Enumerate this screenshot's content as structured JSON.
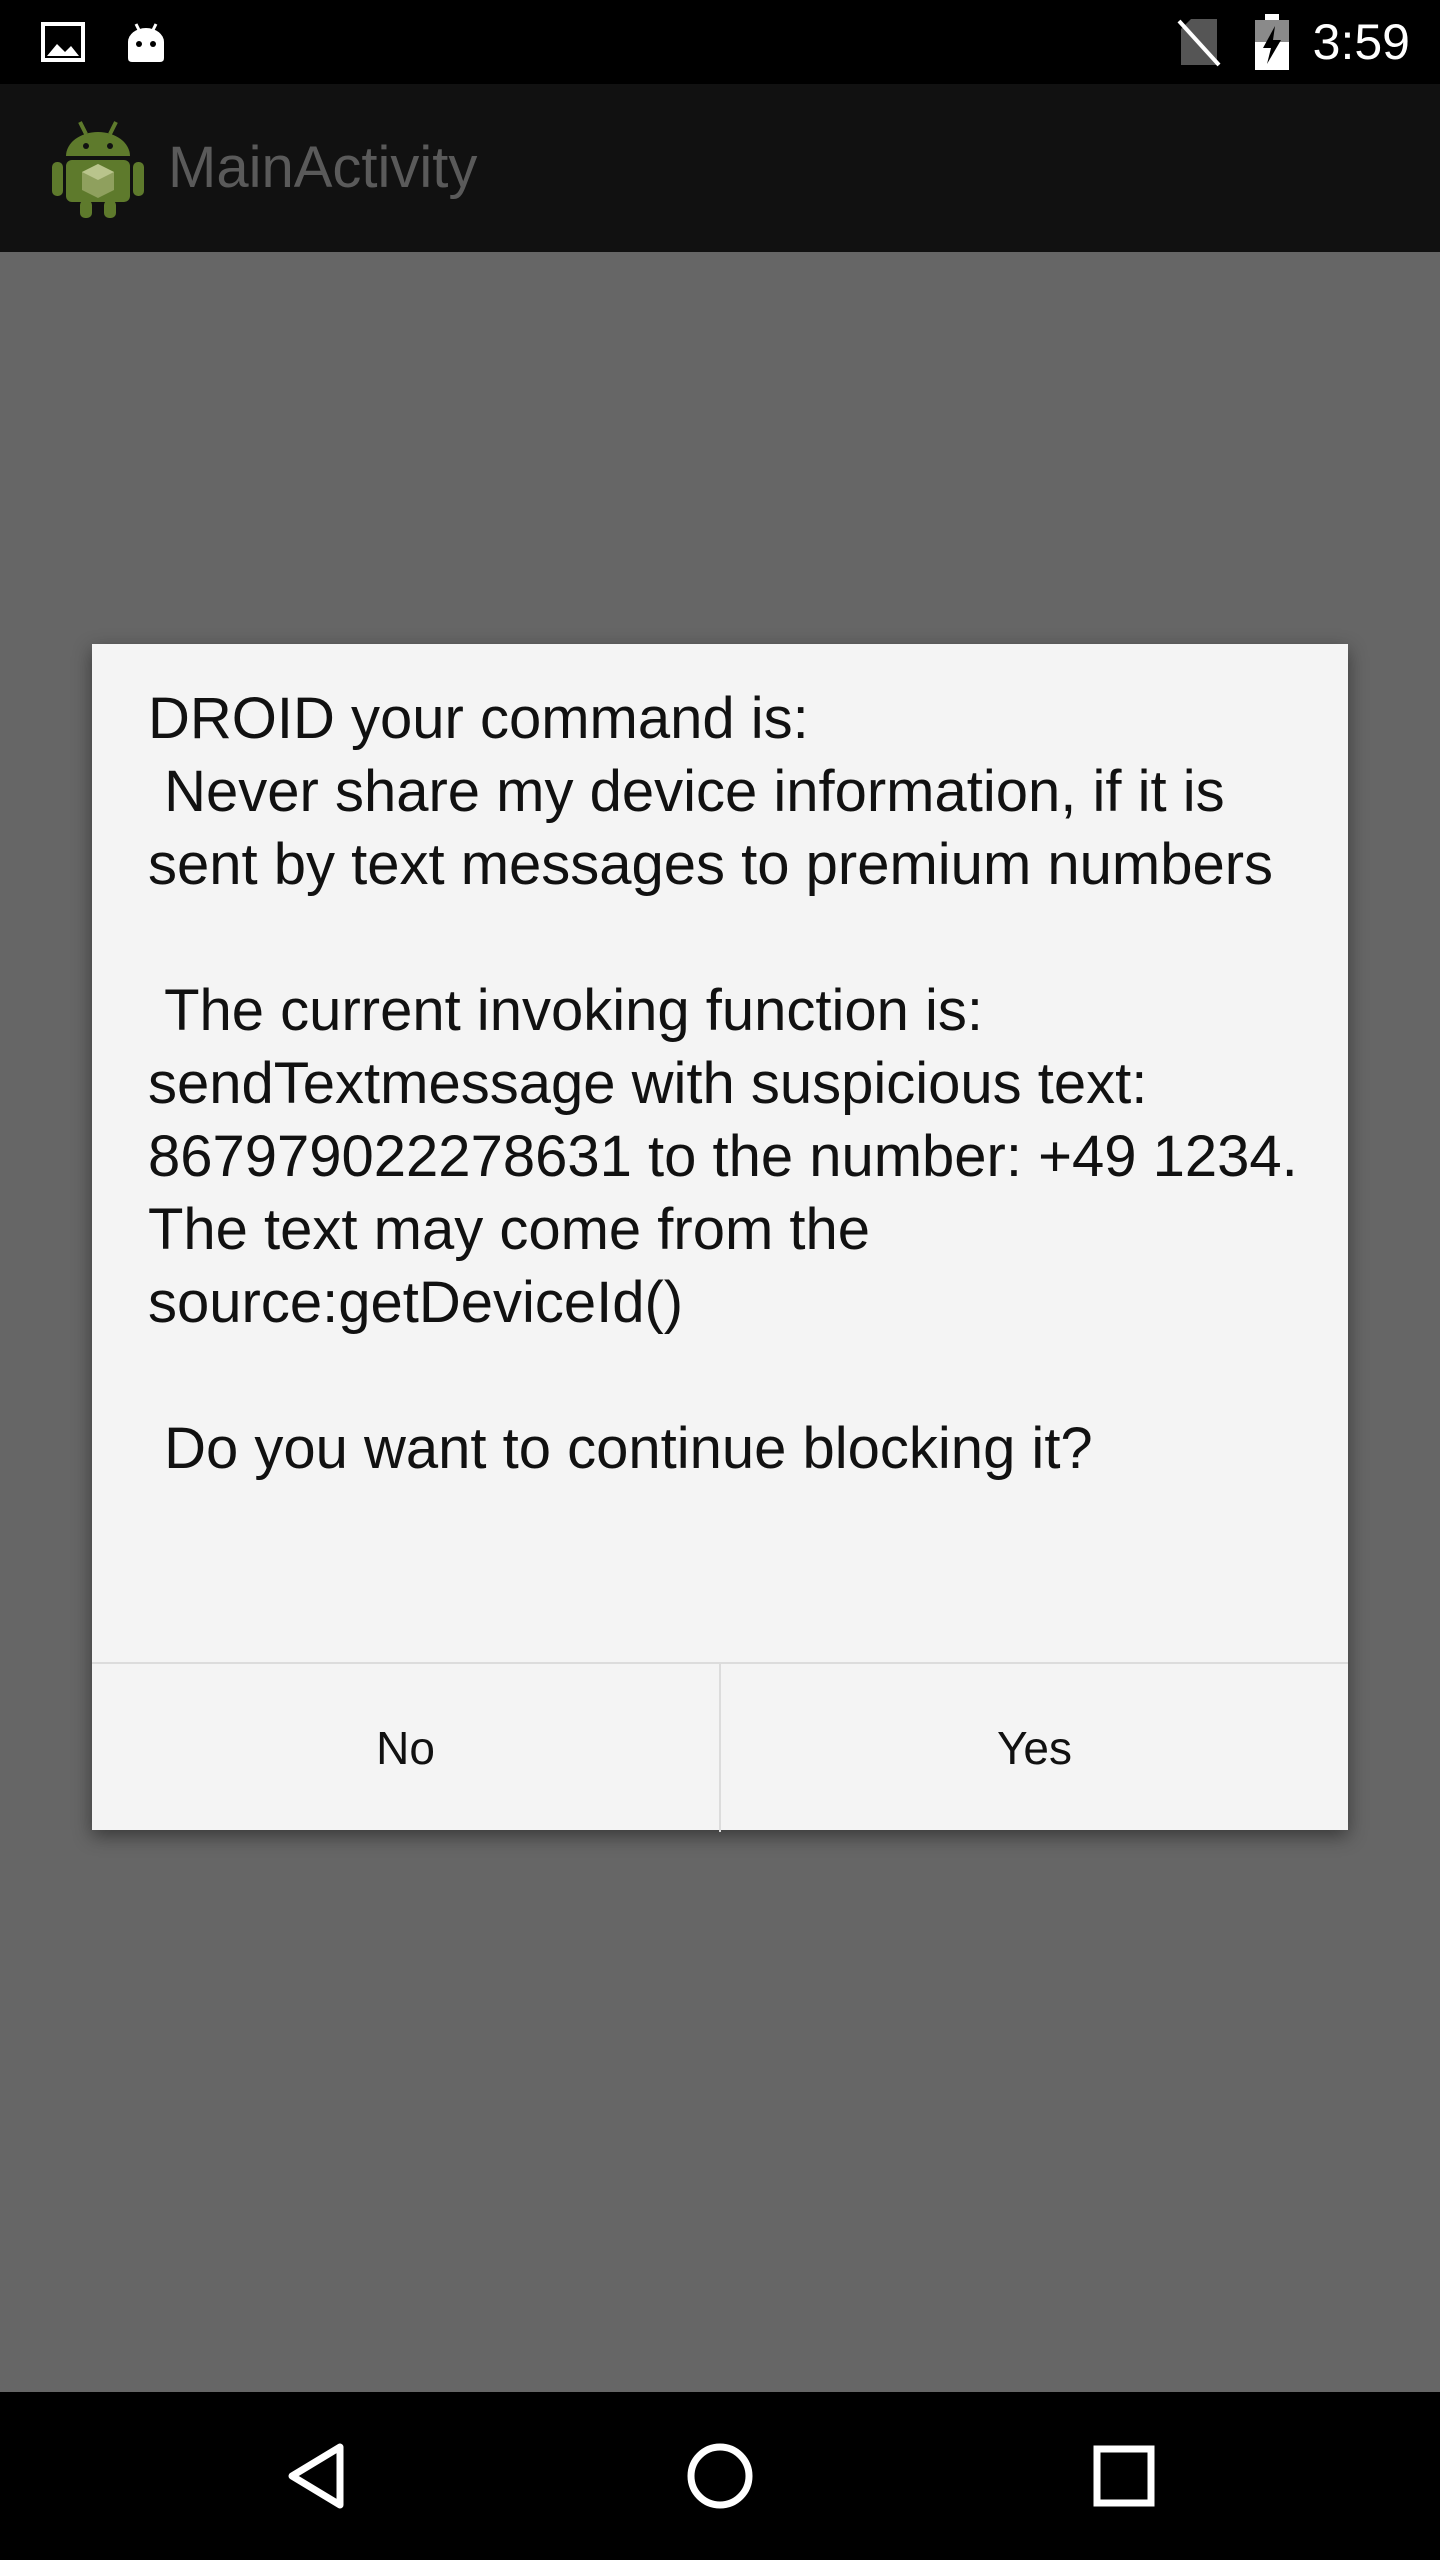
{
  "status_bar": {
    "time": "3:59",
    "icons": [
      "image-icon",
      "android-icon",
      "no-sim-icon",
      "battery-charging-icon"
    ]
  },
  "action_bar": {
    "title": "MainActivity",
    "icon": "android-app-icon"
  },
  "dialog": {
    "message": "DROID your command is:\n Never share my device information, if it is sent by text messages to premium numbers\n\n The current invoking function is: sendTextmessage with suspicious text: 867979022278631 to the number: +49 1234.\nThe text may come from the source:getDeviceId()\n\n Do you want to continue blocking it?",
    "buttons": {
      "no": "No",
      "yes": "Yes"
    }
  },
  "nav_bar": {
    "icons": [
      "back-icon",
      "home-icon",
      "recents-icon"
    ]
  },
  "colors": {
    "status_bar": "#000000",
    "action_bar": "#111111",
    "dim_background": "#666666",
    "dialog_background": "#f4f4f4",
    "title_text": "#5a5a5a",
    "android_green": "#5e7a2c"
  }
}
